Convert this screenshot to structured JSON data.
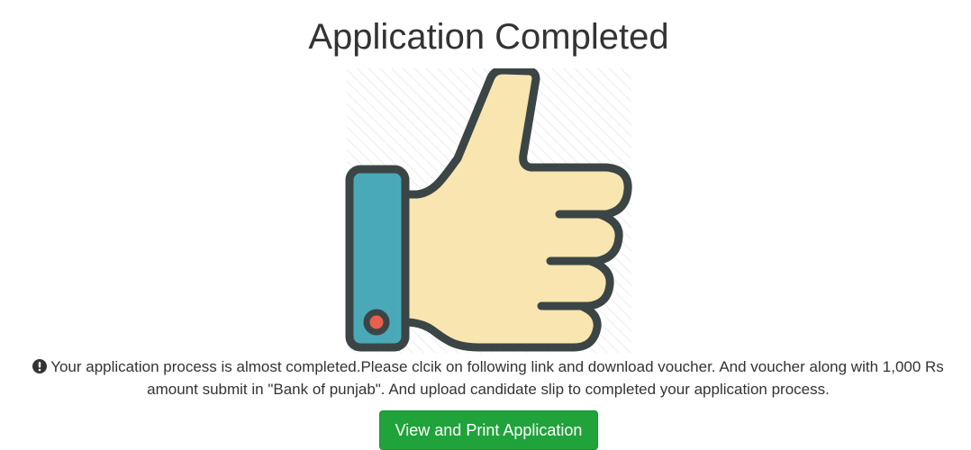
{
  "page": {
    "title": "Application Completed"
  },
  "illustration": {
    "icon": "thumbs-up-icon",
    "colors": {
      "hand": "#f8e5b0",
      "cuff": "#4aa9b8",
      "outline": "#3c4545",
      "dot": "#e8604c",
      "hatch": "#ececec"
    }
  },
  "notice": {
    "icon": "info-circle-icon",
    "text": "Your application process is almost completed.Please clcik on following link and download voucher. And voucher along with 1,000 Rs amount submit in \"Bank of punjab\". And upload candidate slip to completed your application process."
  },
  "actions": {
    "view_print_label": "View and Print Application",
    "button_color": "#1fa33a"
  }
}
